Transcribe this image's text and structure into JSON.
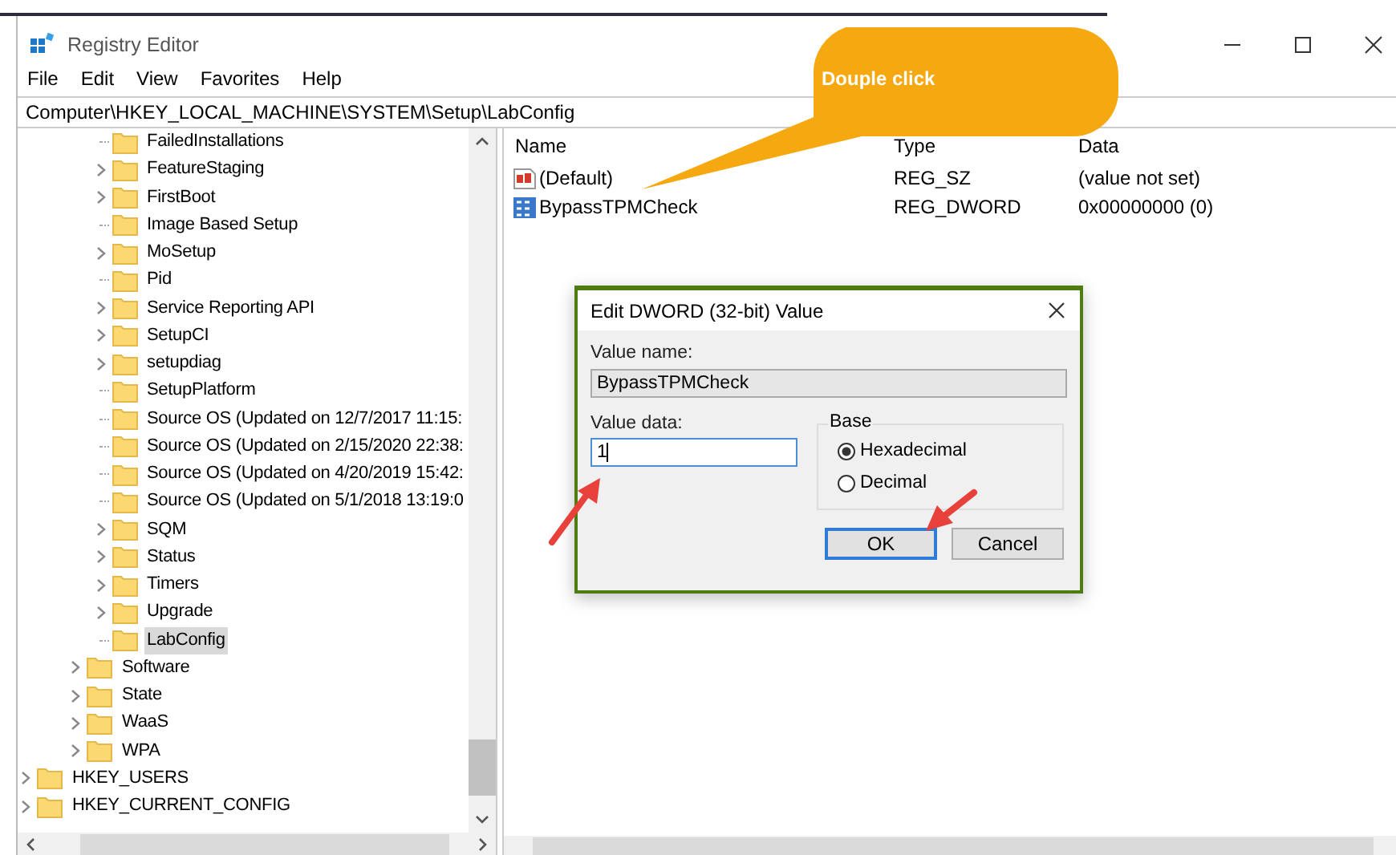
{
  "window": {
    "title": "Registry Editor"
  },
  "menu": [
    "File",
    "Edit",
    "View",
    "Favorites",
    "Help"
  ],
  "address": "Computer\\HKEY_LOCAL_MACHINE\\SYSTEM\\Setup\\LabConfig",
  "tree": {
    "items": [
      {
        "children": [
          {
            "children": [
              {
                "children": [
                  {
                    "label": "FailedInstallations",
                    "expandable": false,
                    "selected": false
                  },
                  {
                    "label": "FeatureStaging",
                    "expandable": true,
                    "selected": false
                  },
                  {
                    "label": "FirstBoot",
                    "expandable": true,
                    "selected": false
                  },
                  {
                    "label": "Image Based Setup",
                    "expandable": false,
                    "selected": false
                  },
                  {
                    "label": "MoSetup",
                    "expandable": true,
                    "selected": false
                  },
                  {
                    "label": "Pid",
                    "expandable": false,
                    "selected": false
                  },
                  {
                    "label": "Service Reporting API",
                    "expandable": true,
                    "selected": false
                  },
                  {
                    "label": "SetupCI",
                    "expandable": true,
                    "selected": false
                  },
                  {
                    "label": "setupdiag",
                    "expandable": true,
                    "selected": false
                  },
                  {
                    "label": "SetupPlatform",
                    "expandable": false,
                    "selected": false
                  },
                  {
                    "label": "Source OS (Updated on 12/7/2017 11:15:",
                    "expandable": false,
                    "selected": false
                  },
                  {
                    "label": "Source OS (Updated on 2/15/2020 22:38:",
                    "expandable": false,
                    "selected": false
                  },
                  {
                    "label": "Source OS (Updated on 4/20/2019 15:42:",
                    "expandable": false,
                    "selected": false
                  },
                  {
                    "label": "Source OS (Updated on 5/1/2018 13:19:0",
                    "expandable": false,
                    "selected": false
                  },
                  {
                    "label": "SQM",
                    "expandable": true,
                    "selected": false
                  },
                  {
                    "label": "Status",
                    "expandable": true,
                    "selected": false
                  },
                  {
                    "label": "Timers",
                    "expandable": true,
                    "selected": false
                  },
                  {
                    "label": "Upgrade",
                    "expandable": true,
                    "selected": false
                  },
                  {
                    "label": "LabConfig",
                    "expandable": false,
                    "selected": true
                  }
                ]
              },
              {
                "label": "Software",
                "expandable": true,
                "selected": false
              },
              {
                "label": "State",
                "expandable": true,
                "selected": false
              },
              {
                "label": "WaaS",
                "expandable": true,
                "selected": false
              },
              {
                "label": "WPA",
                "expandable": true,
                "selected": false
              }
            ]
          }
        ]
      },
      {
        "label": "HKEY_USERS",
        "expandable": true,
        "selected": false
      },
      {
        "label": "HKEY_CURRENT_CONFIG",
        "expandable": true,
        "selected": false
      }
    ]
  },
  "values": {
    "columns": [
      "Name",
      "Type",
      "Data"
    ],
    "rows": [
      {
        "kind": "string",
        "name": "(Default)",
        "type": "REG_SZ",
        "data": "(value not set)"
      },
      {
        "kind": "binary",
        "name": "BypassTPMCheck",
        "type": "REG_DWORD",
        "data": "0x00000000 (0)"
      }
    ]
  },
  "dialog": {
    "title": "Edit DWORD (32-bit) Value",
    "value_name_label": "Value name:",
    "value_name": "BypassTPMCheck",
    "value_data_label": "Value data:",
    "value_data": "1",
    "base_label": "Base",
    "bases": [
      {
        "label": "Hexadecimal",
        "selected": true
      },
      {
        "label": "Decimal",
        "selected": false
      }
    ],
    "buttons": [
      {
        "label": "OK",
        "default": true
      },
      {
        "label": "Cancel",
        "default": false
      }
    ]
  },
  "callout": {
    "text": "Douple click"
  }
}
